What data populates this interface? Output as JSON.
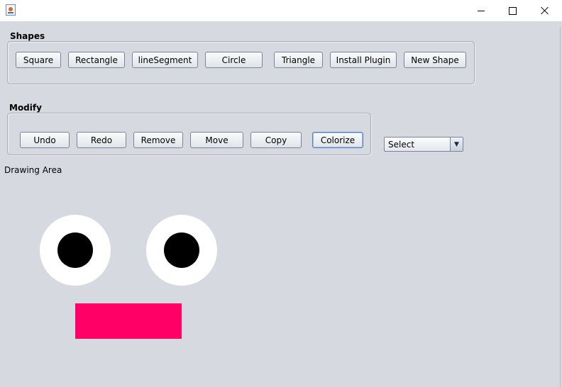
{
  "window": {
    "icon": "java-cup-icon",
    "minimize_icon": "minimize-icon",
    "maximize_icon": "maximize-icon",
    "close_icon": "close-icon"
  },
  "shapes_panel": {
    "label": "Shapes",
    "buttons": [
      "Square",
      "Rectangle",
      "lineSegment",
      "Circle",
      "Triangle",
      "Install Plugin",
      "New Shape"
    ]
  },
  "modify_panel": {
    "label": "Modify",
    "buttons": [
      "Undo",
      "Redo",
      "Remove",
      "Move",
      "Copy",
      "Colorize"
    ],
    "focused_button": "Colorize"
  },
  "select": {
    "value": "Select",
    "arrow_icon": "triangle-down-icon"
  },
  "drawing_area": {
    "label": "Drawing Area",
    "shapes": [
      {
        "type": "circle",
        "fill": "#ffffff"
      },
      {
        "type": "circle",
        "fill": "#000000"
      },
      {
        "type": "circle",
        "fill": "#ffffff"
      },
      {
        "type": "circle",
        "fill": "#000000"
      },
      {
        "type": "rectangle",
        "fill": "#ff0066"
      }
    ]
  },
  "colors": {
    "background": "#d6d9df",
    "titlebar": "#ffffff",
    "rectangle_fill": "#ff0066"
  }
}
